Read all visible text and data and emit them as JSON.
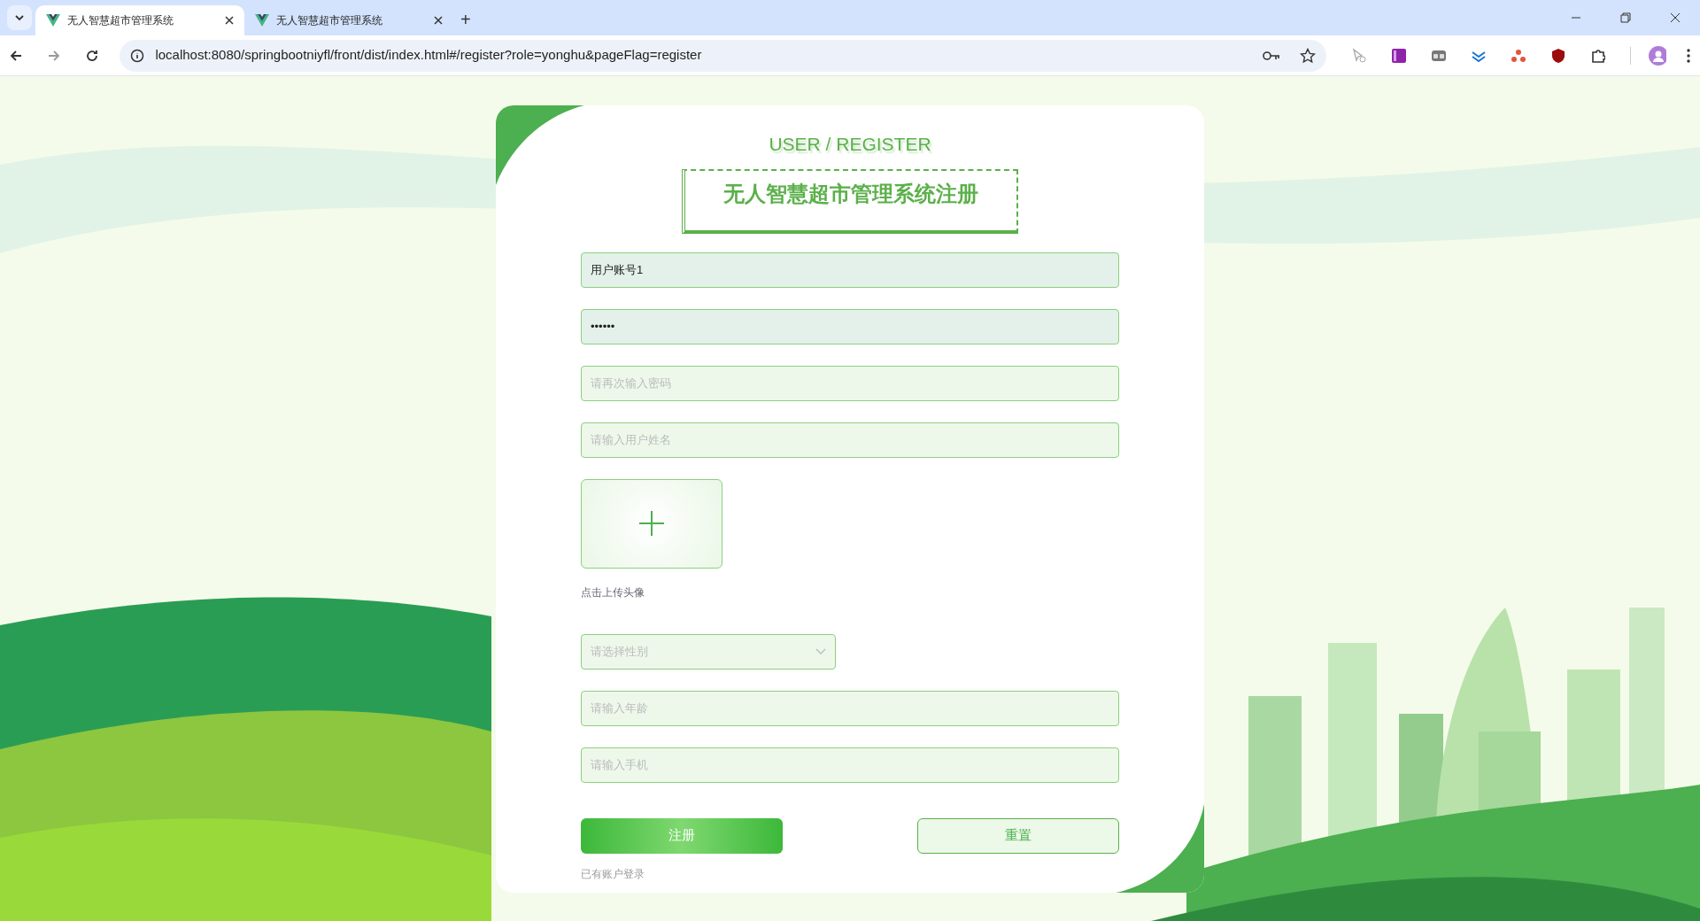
{
  "browser": {
    "tabs": [
      {
        "title": "无人智慧超市管理系统",
        "selected": true
      },
      {
        "title": "无人智慧超市管理系统",
        "selected": false
      }
    ],
    "new_tab": "+",
    "url": "localhost:8080/springbootniyfl/front/dist/index.html#/register?role=yonghu&pageFlag=register"
  },
  "form": {
    "heading": "USER / REGISTER",
    "title": "无人智慧超市管理系统注册",
    "fields": [
      {
        "kind": "input",
        "value": "用户账号1"
      },
      {
        "kind": "input",
        "value": "••••••"
      },
      {
        "kind": "input",
        "placeholder": "请再次输入密码"
      },
      {
        "kind": "input",
        "placeholder": "请输入用户姓名"
      },
      {
        "kind": "upload",
        "caption": "点击上传头像"
      },
      {
        "kind": "select",
        "placeholder": "请选择性别"
      },
      {
        "kind": "input",
        "placeholder": "请输入年龄"
      },
      {
        "kind": "input",
        "placeholder": "请输入手机"
      }
    ],
    "buttons": [
      {
        "kind": "primary",
        "label": "注册"
      },
      {
        "kind": "outline",
        "label": "重置"
      }
    ],
    "login_link": "已有账户登录"
  }
}
